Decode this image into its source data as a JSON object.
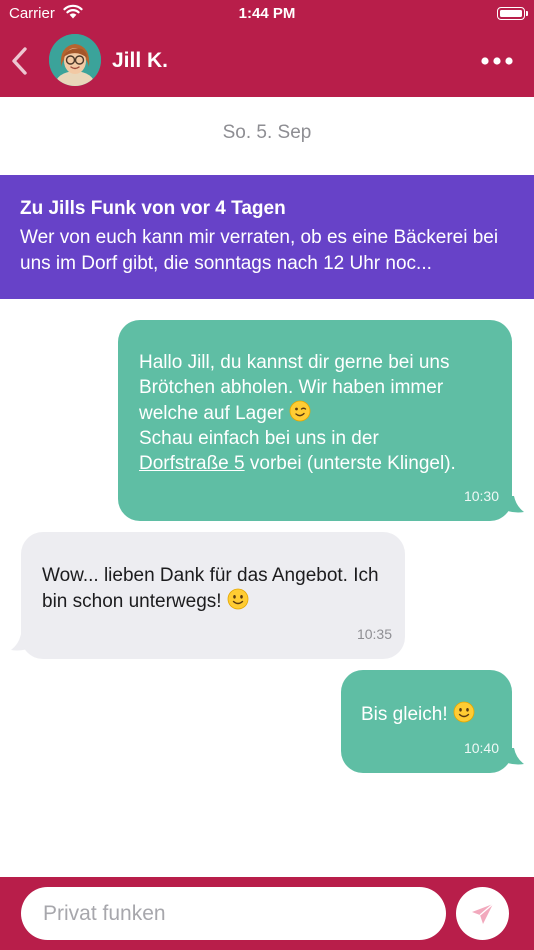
{
  "status_bar": {
    "carrier": "Carrier",
    "time": "1:44 PM",
    "battery_level": 1.0
  },
  "header": {
    "contact_name": "Jill K.",
    "back_icon": "chevron-left-icon",
    "more_icon": "ellipsis-icon"
  },
  "chat": {
    "date_label": "So. 5. Sep",
    "reference": {
      "title": "Zu Jills Funk von vor 4 Tagen",
      "body": "Wer von euch kann mir verraten, ob es eine Bäckerei bei uns im Dorf gibt, die sonntags nach 12 Uhr noc..."
    },
    "messages": [
      {
        "direction": "outgoing",
        "line1": "Hallo Jill, du kannst dir gerne bei uns Brötchen abholen. Wir haben immer welche auf Lager",
        "line2": "Schau einfach bei uns in der",
        "link": "Dorfstraße 5",
        "line3": "vorbei (unterste Klingel).",
        "emoji": "winking-face",
        "time": "10:30"
      },
      {
        "direction": "incoming",
        "text": "Wow... lieben Dank für das Angebot. Ich bin schon unterwegs!",
        "emoji": "smiling-face",
        "time": "10:35"
      },
      {
        "direction": "outgoing",
        "text": "Bis gleich!",
        "emoji": "smiling-face",
        "time": "10:40"
      }
    ]
  },
  "composer": {
    "placeholder": "Privat funken",
    "value": "",
    "send_icon": "paper-plane-icon"
  },
  "colors": {
    "brand": "#b81e4a",
    "reference": "#6742c8",
    "outgoing": "#5fbea4",
    "incoming": "#ededf1"
  }
}
